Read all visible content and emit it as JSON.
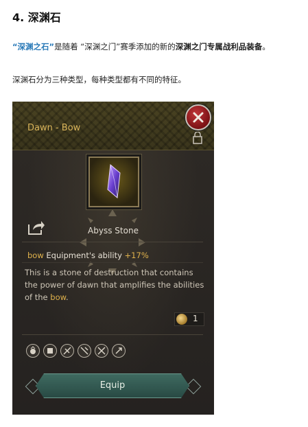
{
  "article": {
    "heading": "4. 深渊石",
    "intro_highlight": "“深渊之石”",
    "intro_mid": "是随着 “深渊之门”赛季添加的新的",
    "intro_bold": "深渊之门专属战利品装备",
    "intro_end": "。",
    "description": "深渊石分为三种类型，每种类型都有不同的特征。"
  },
  "panel": {
    "title": "Dawn - Bow",
    "close_label": "close",
    "item_name": "Abyss Stone",
    "ability_keyword": "bow",
    "ability_text": "Equipment's ability",
    "ability_value": "+17%",
    "flavor_text": "This is a stone of destruction that contains the power of dawn that amplifies the abilities of the",
    "flavor_keyword": "bow",
    "flavor_end": ".",
    "quantity": "1",
    "equip_label": "Equip"
  },
  "colors": {
    "accent_gold": "#e0b24c",
    "title_gold": "#d9b45a",
    "link_blue": "#2a7ab8",
    "close_red": "#a41f24",
    "button_teal": "#3f6a60"
  },
  "icons": [
    "close-icon",
    "lock-icon",
    "share-icon",
    "coin-icon",
    "class-icon",
    "crystal-icon"
  ]
}
